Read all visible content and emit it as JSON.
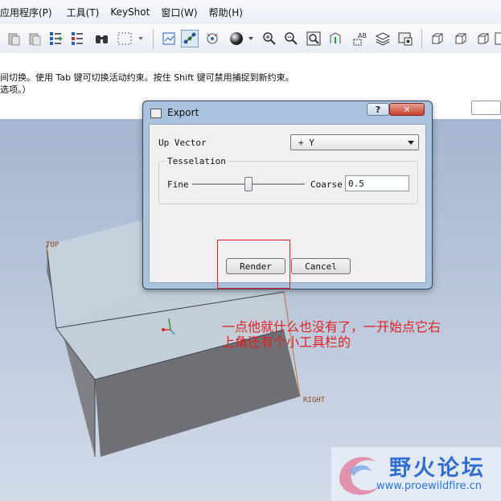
{
  "menu": [
    "应用程序(P)",
    "工具(T)",
    "KeyShot",
    "窗口(W)",
    "帮助(H)"
  ],
  "hint": {
    "line1": "间切换。使用 Tab 键可切换活动约束。按住 Shift 键可禁用捕捉到新约束。",
    "line2": "选项。）"
  },
  "toolbar_icons": [
    "paste-icon",
    "paste-special-icon",
    "regenerate-icon",
    "regenerate-manager-icon",
    "find-icon",
    "select-box-icon",
    "refit-icon",
    "datum-display-icon",
    "spin-center-icon",
    "shading-icon",
    "zoom-in-icon",
    "zoom-out-icon",
    "zoom-fit-icon",
    "orient-icon",
    "annotation-icon",
    "layers-icon",
    "view-manager-icon",
    "saved-view-icon",
    "view-cube-icon",
    "view-iso-icon",
    "view-panel-icon"
  ],
  "viewport": {
    "label_top": "TOP",
    "label_right": "RIGHT"
  },
  "dialog": {
    "title": "Export",
    "help_glyph": "?",
    "close_glyph": "✕",
    "up_vector_label": "Up Vector",
    "up_vector_value": "+ Y",
    "tesselation_label": "Tesselation",
    "fine_label": "Fine",
    "coarse_label": "Coarse",
    "coarse_value": "0.5",
    "slider_value": 0.5,
    "render_label": "Render",
    "cancel_label": "Cancel"
  },
  "annotation": {
    "line1": "一点他就什么也没有了，一开始点它右",
    "line2": "上角还有个小工具栏的",
    "color": "#e02020"
  },
  "watermark": {
    "title": "野火论坛",
    "url": "www.proewildfire.cn"
  }
}
